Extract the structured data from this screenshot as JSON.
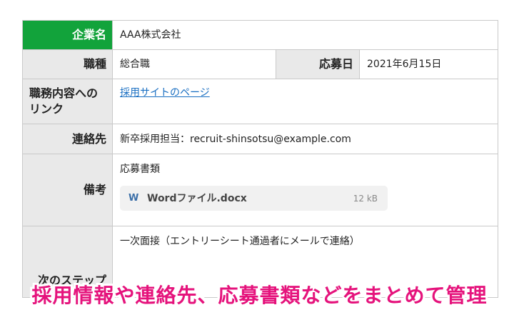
{
  "rows": {
    "company": {
      "label": "企業名",
      "value": "AAA株式会社"
    },
    "position": {
      "label": "職種",
      "value": "総合職"
    },
    "applied_date": {
      "label": "応募日",
      "value": "2021年6月15日"
    },
    "job_link": {
      "label": "職務内容へのリンク",
      "value": "採用サイトのページ"
    },
    "contact": {
      "label": "連絡先",
      "value": "新卒採用担当：recruit-shinsotsu@example.com"
    },
    "notes": {
      "label": "備考",
      "value": "応募書類",
      "attachment": {
        "icon": "W",
        "name": "Wordファイル.docx",
        "size": "12 kB"
      }
    },
    "next_step": {
      "label": "次のステップ",
      "value": "一次面接（エントリーシート通過者にメールで連絡）"
    }
  },
  "caption": "採用情報や連絡先、応募書類などをまとめて管理",
  "colors": {
    "header_green": "#12a33b",
    "label_gray": "#e9e9e9",
    "link_blue": "#1a6fc2",
    "caption_pink": "#e5137c"
  }
}
